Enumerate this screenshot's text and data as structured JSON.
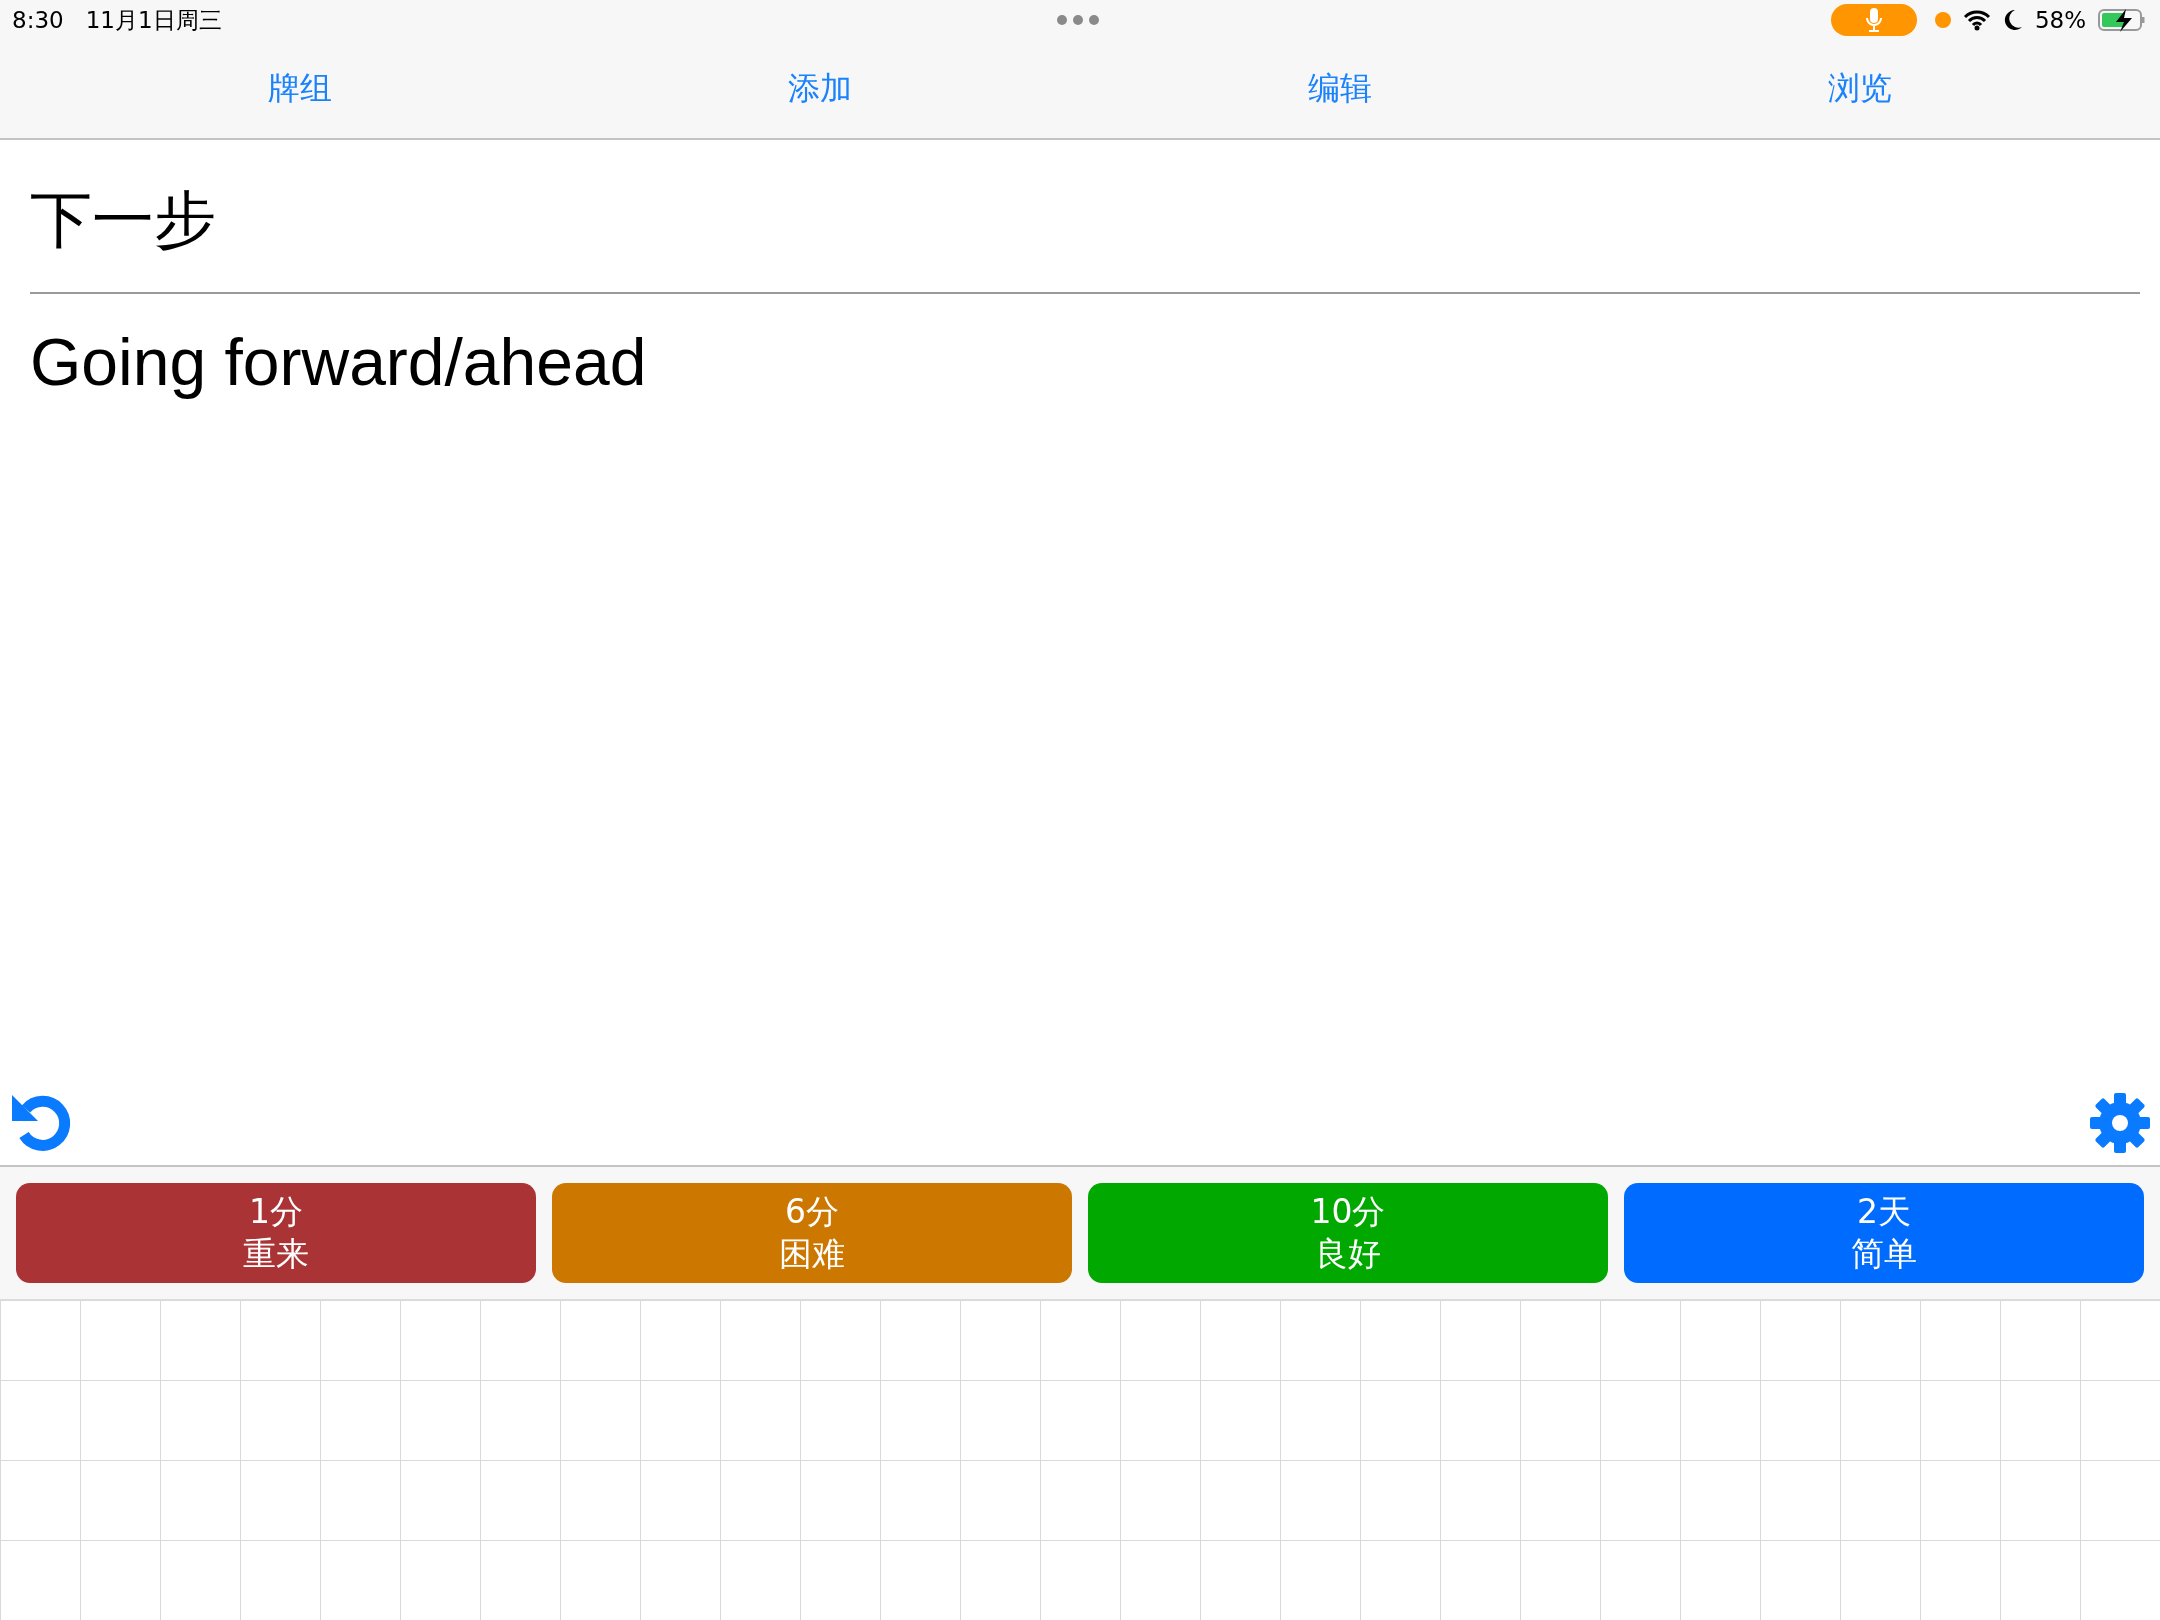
{
  "status_bar": {
    "time": "8:30",
    "date": "11月1日周三",
    "battery": "58%"
  },
  "toolbar": [
    {
      "label": "牌组"
    },
    {
      "label": "添加"
    },
    {
      "label": "编辑"
    },
    {
      "label": "浏览"
    }
  ],
  "card": {
    "front": "下一步",
    "back": "Going forward/ahead"
  },
  "answer_buttons": [
    {
      "interval": "1分",
      "label": "重来",
      "color": "#aa3335"
    },
    {
      "interval": "6分",
      "label": "困难",
      "color": "#cb7700"
    },
    {
      "interval": "10分",
      "label": "良好",
      "color": "#00a800"
    },
    {
      "interval": "2天",
      "label": "简单",
      "color": "#006cff"
    }
  ]
}
